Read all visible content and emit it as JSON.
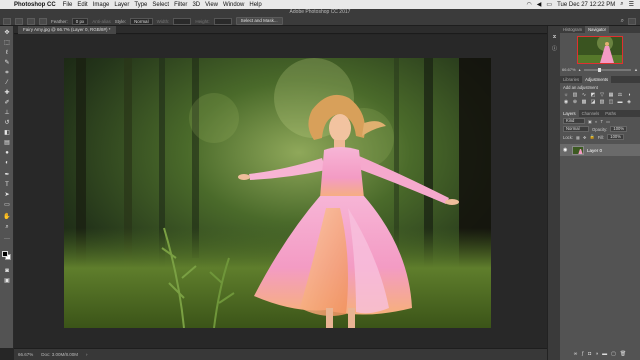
{
  "menubar": {
    "app_name": "Photoshop CC",
    "items": [
      "File",
      "Edit",
      "Image",
      "Layer",
      "Type",
      "Select",
      "Filter",
      "3D",
      "View",
      "Window",
      "Help"
    ],
    "clock": "Tue Dec 27  12:22 PM"
  },
  "window": {
    "title": "Adobe Photoshop CC 2017"
  },
  "options_bar": {
    "tool_label": "Feather:",
    "feather_value": "0 px",
    "antialias_label": "Anti-alias",
    "style_label": "Style:",
    "style_value": "Normal",
    "width_label": "Width:",
    "height_label": "Height:",
    "select_mask_button": "Select and Mask..."
  },
  "document": {
    "tab_label": "Fairy Amy.jpg @ 66.7% (Layer 0, RGB/8#) *"
  },
  "status_bar": {
    "zoom": "66.67%",
    "doc_size": "Doc: 3.00M/8.00M"
  },
  "navigator": {
    "tabs": [
      "Histogram",
      "Navigator"
    ],
    "active_tab": "Navigator",
    "zoom": "66.67%"
  },
  "adjustments": {
    "tabs": [
      "Libraries",
      "Adjustments"
    ],
    "active_tab": "Adjustments",
    "title": "Add an adjustment"
  },
  "layers": {
    "tabs": [
      "Layers",
      "Channels",
      "Paths"
    ],
    "active_tab": "Layers",
    "kind_label": "Kind",
    "blend_mode": "Normal",
    "opacity_label": "Opacity:",
    "opacity_value": "100%",
    "lock_label": "Lock:",
    "fill_label": "Fill:",
    "fill_value": "100%",
    "items": [
      {
        "name": "Layer 0"
      }
    ]
  },
  "icons": {
    "tools": [
      "move-icon",
      "marquee-icon",
      "lasso-icon",
      "quick-select-icon",
      "crop-icon",
      "eyedropper-icon",
      "healing-icon",
      "brush-icon",
      "stamp-icon",
      "history-brush-icon",
      "eraser-icon",
      "gradient-icon",
      "blur-icon",
      "dodge-icon",
      "pen-icon",
      "type-icon",
      "path-select-icon",
      "rectangle-icon",
      "hand-icon",
      "zoom-icon"
    ]
  },
  "colors": {
    "ui_dark": "#282828",
    "panel": "#535353",
    "menubar": "#e9e9e9",
    "dress_pink": "#f4a6cc",
    "forest_green": "#3d5a22"
  }
}
